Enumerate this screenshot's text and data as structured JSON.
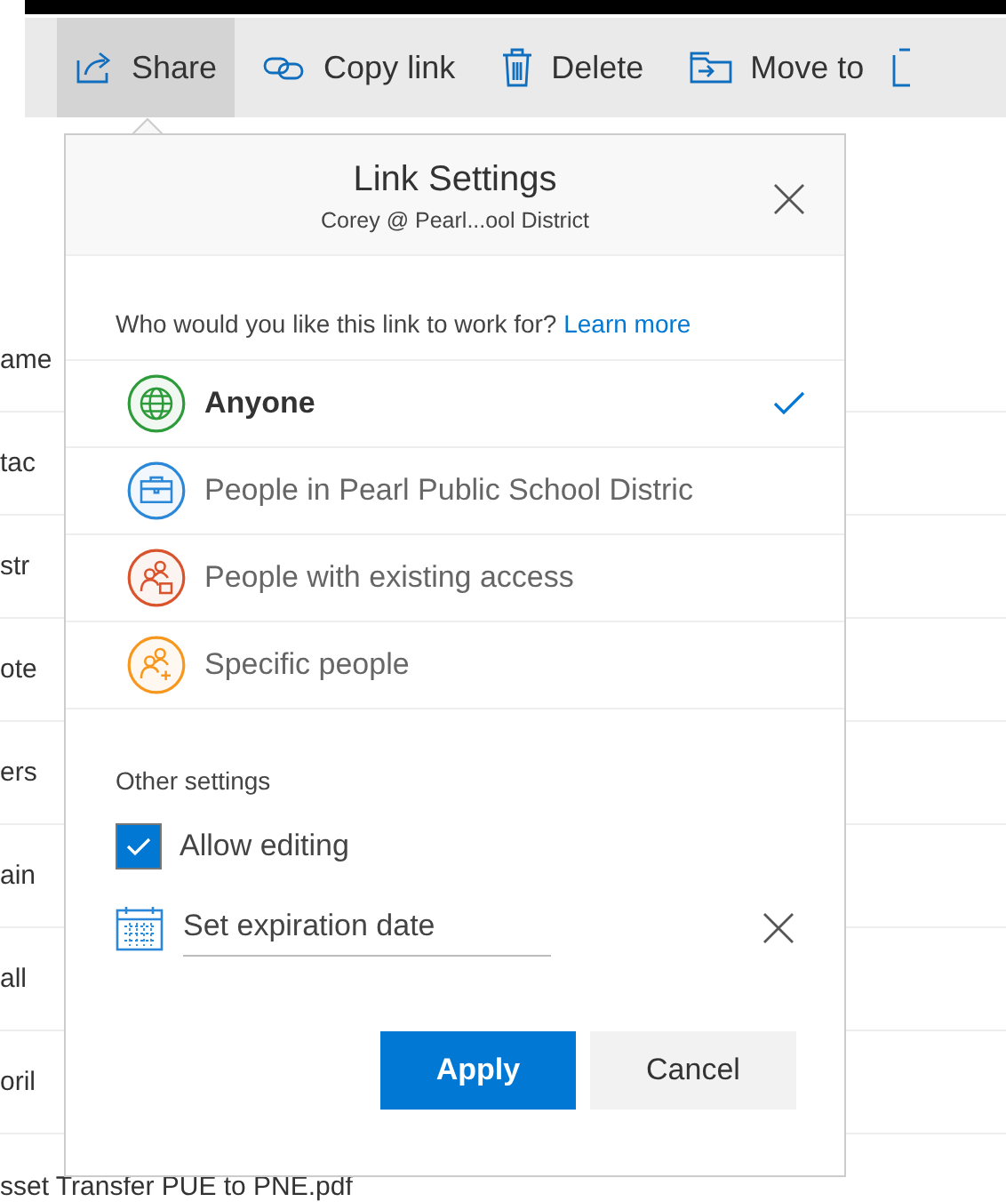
{
  "toolbar": {
    "items": [
      {
        "label": "Share",
        "kind": "share",
        "selected": true
      },
      {
        "label": "Copy link",
        "kind": "link",
        "selected": false
      },
      {
        "label": "Delete",
        "kind": "delete",
        "selected": false
      },
      {
        "label": "Move to",
        "kind": "move",
        "selected": false
      }
    ]
  },
  "file_list": {
    "rows": [
      "ame",
      "tac",
      "str",
      "ote",
      "ers",
      "ain",
      "all",
      "oril",
      "sset Transfer PUE to PNE.pdf"
    ]
  },
  "dialog": {
    "title": "Link Settings",
    "subtitle": "Corey @ Pearl...ool District",
    "question": "Who would you like this link to work for?",
    "learn_more": "Learn more",
    "options": [
      {
        "label": "Anyone",
        "kind": "globe",
        "color": "#2e9b3a",
        "selected": true
      },
      {
        "label": "People in Pearl Public School Distric",
        "kind": "briefcase",
        "color": "#2b88d8",
        "selected": false
      },
      {
        "label": "People with existing access",
        "kind": "people-lock",
        "color": "#d9532c",
        "selected": false
      },
      {
        "label": "Specific people",
        "kind": "people-add",
        "color": "#f7971d",
        "selected": false
      }
    ],
    "other_settings": "Other settings",
    "allow_editing": {
      "label": "Allow editing",
      "checked": true
    },
    "expiration": {
      "placeholder": "Set expiration date"
    },
    "buttons": [
      {
        "label": "Apply",
        "kind": "primary"
      },
      {
        "label": "Cancel",
        "kind": "secondary"
      }
    ]
  }
}
